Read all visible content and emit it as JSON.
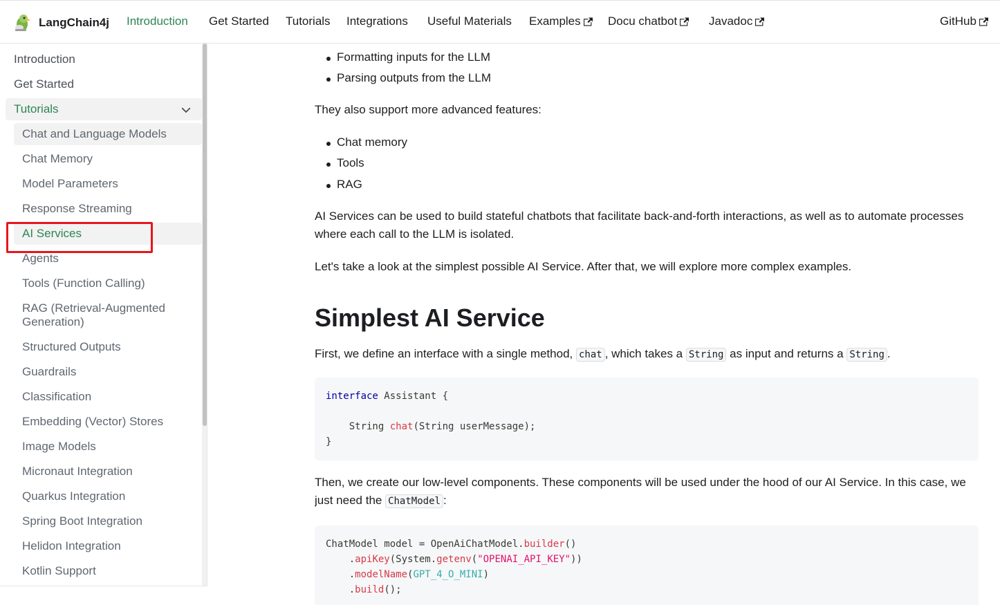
{
  "navbar": {
    "brand": "LangChain4j",
    "items": [
      {
        "label": "Introduction",
        "active": true
      },
      {
        "label": "Get Started"
      },
      {
        "label": "Tutorials"
      },
      {
        "label": "Integrations"
      },
      {
        "label": "Useful Materials"
      },
      {
        "label": "Examples",
        "external": true
      },
      {
        "label": "Docu chatbot",
        "external": true
      },
      {
        "label": "Javadoc",
        "external": true
      },
      {
        "label": "GitHub",
        "external": true
      }
    ]
  },
  "sidebar": {
    "top_items": [
      "Introduction",
      "Get Started"
    ],
    "category": "Tutorials",
    "sub_items": [
      "Chat and Language Models",
      "Chat Memory",
      "Model Parameters",
      "Response Streaming",
      "AI Services",
      "Agents",
      "Tools (Function Calling)",
      "RAG (Retrieval-Augmented Generation)",
      "Structured Outputs",
      "Guardrails",
      "Classification",
      "Embedding (Vector) Stores",
      "Image Models",
      "Micronaut Integration",
      "Quarkus Integration",
      "Spring Boot Integration",
      "Helidon Integration",
      "Kotlin Support"
    ],
    "active_item": "AI Services"
  },
  "content": {
    "list1": [
      "Formatting inputs for the LLM",
      "Parsing outputs from the LLM"
    ],
    "p_advanced": "They also support more advanced features:",
    "list2": [
      "Chat memory",
      "Tools",
      "RAG"
    ],
    "p_stateful": "AI Services can be used to build stateful chatbots that facilitate back-and-forth interactions, as well as to automate processes where each call to the LLM is isolated.",
    "p_lookat": "Let's take a look at the simplest possible AI Service. After that, we will explore more complex examples.",
    "heading": "Simplest AI Service",
    "p_define": {
      "a": "First, we define an interface with a single method, ",
      "code1": "chat",
      "b": ", which takes a ",
      "code2": "String",
      "c": " as input and returns a ",
      "code3": "String",
      "d": "."
    },
    "code1": {
      "l1_kw": "interface",
      "l1_rest": " Assistant {",
      "l2_a": "    String ",
      "l2_fn": "chat",
      "l2_b": "(String userMessage);",
      "l3": "}"
    },
    "p_then": {
      "a": "Then, we create our low-level components. These components will be used under the hood of our AI Service. In this case, we just need the ",
      "code": "ChatModel",
      "b": ":"
    },
    "code2": {
      "l1_a": "ChatModel model = OpenAiChatModel.",
      "l1_fn": "builder",
      "l1_b": "()",
      "l2_a": "    .",
      "l2_fn": "apiKey",
      "l2_b": "(System.",
      "l2_fn2": "getenv",
      "l2_c": "(",
      "l2_str": "\"OPENAI_API_KEY\"",
      "l2_d": "))",
      "l3_a": "    .",
      "l3_fn": "modelName",
      "l3_b": "(",
      "l3_cst": "GPT_4_O_MINI",
      "l3_c": ")",
      "l4_a": "    .",
      "l4_fn": "build",
      "l4_b": "();"
    }
  },
  "colors": {
    "accent": "#2e8555",
    "highlight_box": "#e8141c"
  }
}
